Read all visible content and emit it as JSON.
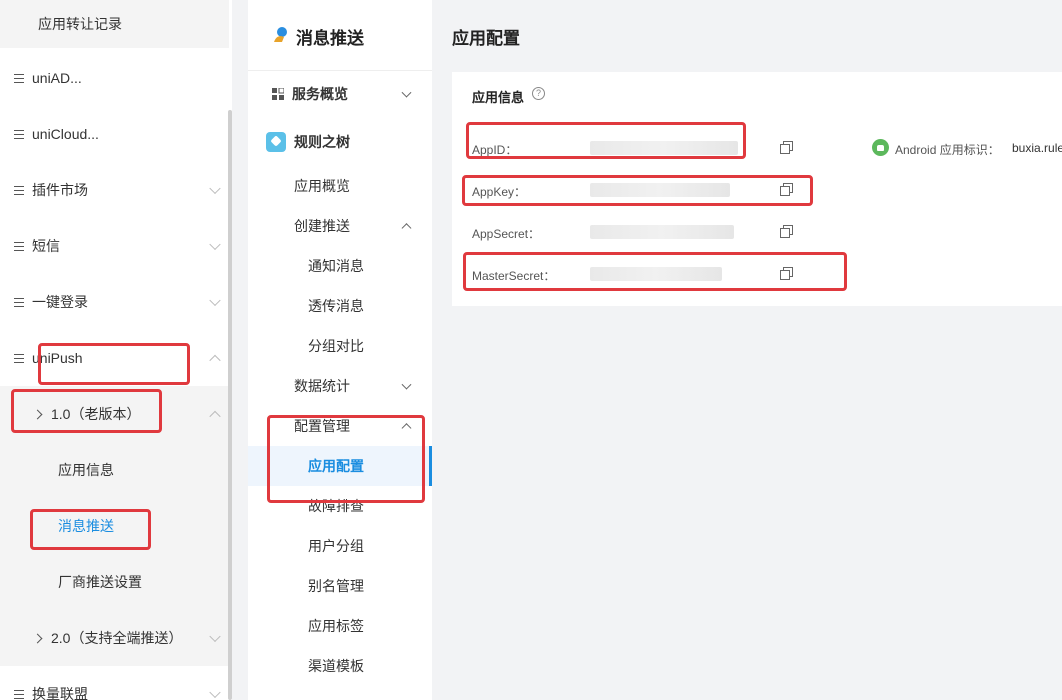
{
  "left_sidebar": {
    "top_item": "应用转让记录",
    "items": [
      {
        "label": "uniAD..."
      },
      {
        "label": "uniCloud..."
      },
      {
        "label": "插件市场"
      },
      {
        "label": "短信"
      },
      {
        "label": "一键登录"
      },
      {
        "label": "uniPush"
      }
    ],
    "v1": {
      "label": "1.0（老版本）",
      "children": [
        "应用信息",
        "消息推送",
        "厂商推送设置"
      ]
    },
    "v2": {
      "label": "2.0（支持全端推送）"
    },
    "bottom_item": "换量联盟"
  },
  "middle_nav": {
    "header": "消息推送",
    "service_overview": "服务概览",
    "app_name": "规则之树",
    "app_overview": "应用概览",
    "create_push": {
      "label": "创建推送",
      "children": [
        "通知消息",
        "透传消息",
        "分组对比"
      ]
    },
    "data_stats": "数据统计",
    "config_mgmt": {
      "label": "配置管理",
      "children": [
        "应用配置",
        "故障排查",
        "用户分组",
        "别名管理",
        "应用标签",
        "渠道模板"
      ]
    }
  },
  "main": {
    "title": "应用配置",
    "card_title": "应用信息",
    "fields": [
      {
        "label": "AppID："
      },
      {
        "label": "AppKey："
      },
      {
        "label": "AppSecret："
      },
      {
        "label": "MasterSecret："
      }
    ],
    "android_label": "Android 应用标识：",
    "android_value": "buxia.rule"
  },
  "colors": {
    "accent": "#1a8de0",
    "highlight": "#e0393e"
  }
}
